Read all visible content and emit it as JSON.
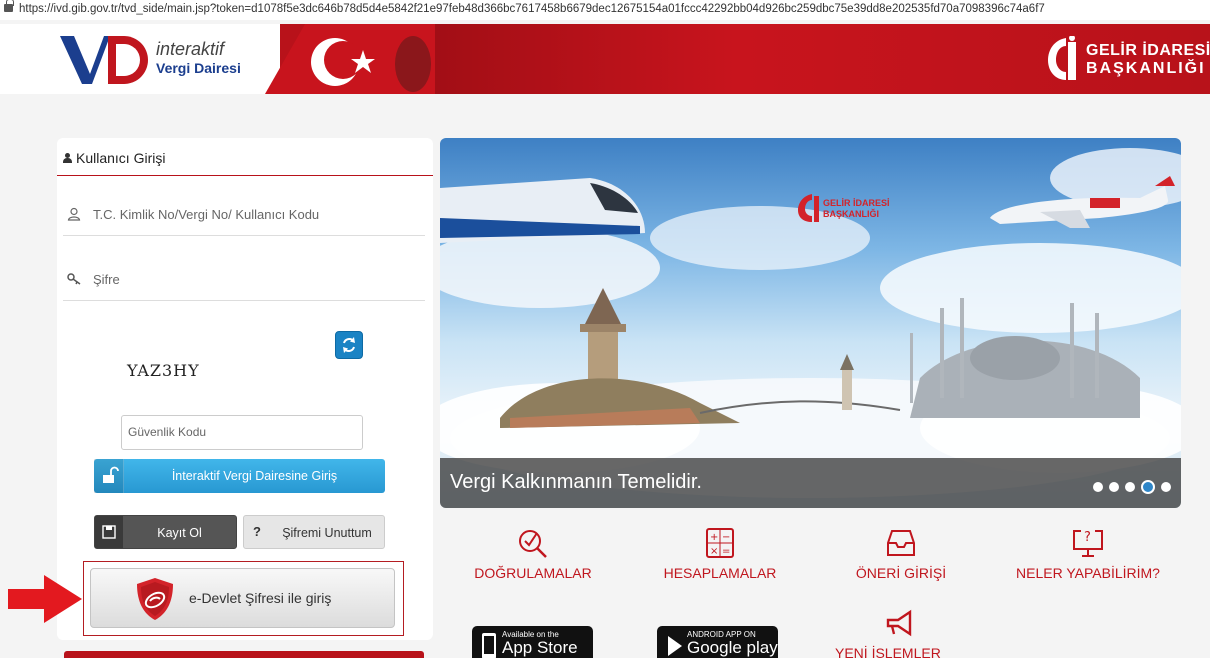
{
  "browser": {
    "url": "https://ivd.gib.gov.tr/tvd_side/main.jsp?token=d1078f5e3dc646b78d5d4e5842f21e97feb48d366bc7617458b6679dec12675154a01fccc42292bb04d926bc259dbc75e39dd8e202535fd70a7098396c74a6f7"
  },
  "header": {
    "logo_line1": "interaktif",
    "logo_line2": "Vergi Dairesi",
    "gib_line1": "GELİR İDARESİ",
    "gib_line2": "BAŞKANLIĞI"
  },
  "login": {
    "title": "Kullanıcı Girişi",
    "username_placeholder": "T.C. Kimlik No/Vergi No/ Kullanıcı Kodu",
    "password_placeholder": "Şifre",
    "captcha": "YAZ3HY",
    "security_code_placeholder": "Güvenlik Kodu",
    "login_button": "İnteraktif Vergi Dairesine Giriş",
    "register_button": "Kayıt Ol",
    "forgot_button": "Şifremi Unuttum",
    "edevlet_button": "e-Devlet Şifresi ile giriş"
  },
  "banner": {
    "caption": "Vergi Kalkınmanın Temelidir.",
    "gib_line1": "GELİR İDARESİ",
    "gib_line2": "BAŞKANLIĞI",
    "slide_count": 5,
    "active_slide": 4
  },
  "quick_links": [
    {
      "label": "DOĞRULAMALAR",
      "icon": "magnifier-check-icon"
    },
    {
      "label": "HESAPLAMALAR",
      "icon": "calculator-icon"
    },
    {
      "label": "ÖNERİ GİRİŞİ",
      "icon": "inbox-icon"
    },
    {
      "label": "NELER YAPABİLİRİM?",
      "icon": "monitor-question-icon"
    }
  ],
  "stores": {
    "apple_small": "Available on the",
    "apple_big": "App Store",
    "google_small": "ANDROID APP ON",
    "google_big": "Google play"
  },
  "yeni_islemler": "YENİ İŞLEMLER",
  "colors": {
    "brand_red": "#b8121a",
    "accent_blue": "#2898d2"
  }
}
